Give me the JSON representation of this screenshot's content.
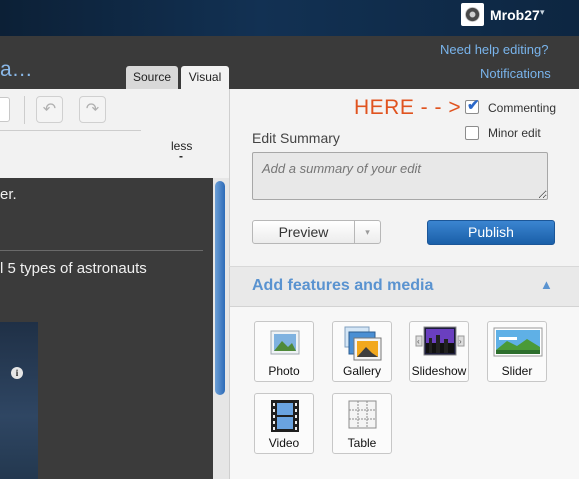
{
  "topbar": {
    "username": "Mrob27",
    "user_caret": "▾"
  },
  "header": {
    "title_fragment": "a…",
    "help_link": "Need help editing?",
    "notifications_link": "Notifications",
    "tabs": [
      {
        "label": "Source"
      },
      {
        "label": "Visual"
      }
    ]
  },
  "editor": {
    "toolbar": {
      "undo_icon": "↶",
      "redo_icon": "↷",
      "less_label": "less",
      "less_dash": "-"
    },
    "content": {
      "line1": "er.",
      "line2": "l 5 types of astronauts",
      "image_info_icon": "i"
    }
  },
  "publish_panel": {
    "annotation": "HERE - - >",
    "checkboxes": [
      {
        "label": "Commenting",
        "checked": true,
        "mark": "✔"
      },
      {
        "label": "Minor edit",
        "checked": false
      }
    ],
    "edit_summary_label": "Edit Summary",
    "summary_placeholder": "Add a summary of your edit",
    "preview_label": "Preview",
    "preview_dropdown_icon": "▾",
    "publish_label": "Publish"
  },
  "features": {
    "title": "Add features and media",
    "collapse_icon": "▲",
    "items": [
      {
        "label": "Photo",
        "icon": "photo-icon"
      },
      {
        "label": "Gallery",
        "icon": "gallery-icon"
      },
      {
        "label": "Slideshow",
        "icon": "slideshow-icon"
      },
      {
        "label": "Slider",
        "icon": "slider-icon"
      },
      {
        "label": "Video",
        "icon": "video-icon"
      },
      {
        "label": "Table",
        "icon": "table-icon"
      }
    ]
  },
  "colors": {
    "accent": "#2b6fbd",
    "annotation": "#e0531f",
    "link": "#79b4ec"
  }
}
